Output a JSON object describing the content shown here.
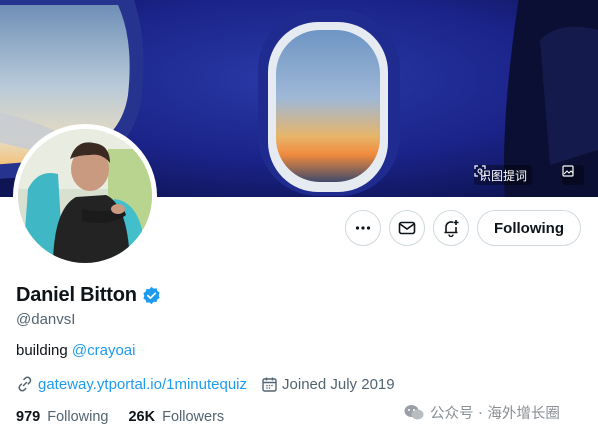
{
  "banner": {
    "image_tool_left_label": "识图提词",
    "image_tool_left_icon": "scan-text-icon",
    "image_tool_right_icon": "image-search-icon"
  },
  "actions": {
    "more_icon": "more-dots-icon",
    "message_icon": "mail-icon",
    "notify_icon": "bell-plus-icon",
    "follow_label": "Following"
  },
  "profile": {
    "display_name": "Daniel Bitton",
    "verified": true,
    "handle": "@danvsI",
    "bio_text": "building ",
    "bio_mention": "@crayoai",
    "website": "gateway.ytportal.io/1minutequiz",
    "joined": "Joined July 2019"
  },
  "stats": {
    "following_count": "979",
    "following_label": "Following",
    "followers_count": "26K",
    "followers_label": "Followers"
  },
  "watermark": {
    "text": "公众号 · 海外增长圈"
  },
  "colors": {
    "accent": "#1d9bf0",
    "text": "#0f1419",
    "secondary_text": "#536471",
    "border": "#cfd9de"
  }
}
